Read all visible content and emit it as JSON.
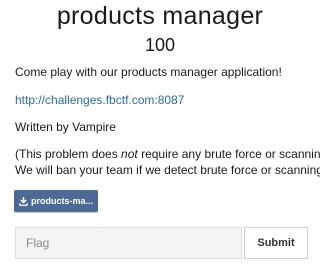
{
  "challenge": {
    "title": "products manager",
    "points": "100",
    "description": "Come play with our products manager application!",
    "link": "http://challenges.fbctf.com:8087",
    "author": "Written by Vampire",
    "note_before": "(This problem does ",
    "note_emphasis": "not",
    "note_after": " require any brute force or scanning.",
    "note_line2": "We will ban your team if we detect brute force or scanning)."
  },
  "download": {
    "label": "products-ma...",
    "icon": "download-icon"
  },
  "flag_form": {
    "placeholder": "Flag",
    "value": "",
    "submit_label": "Submit"
  },
  "colors": {
    "link": "#2a6aa8",
    "download_button": "#4b6a95",
    "input_background": "#f4f4f4"
  }
}
